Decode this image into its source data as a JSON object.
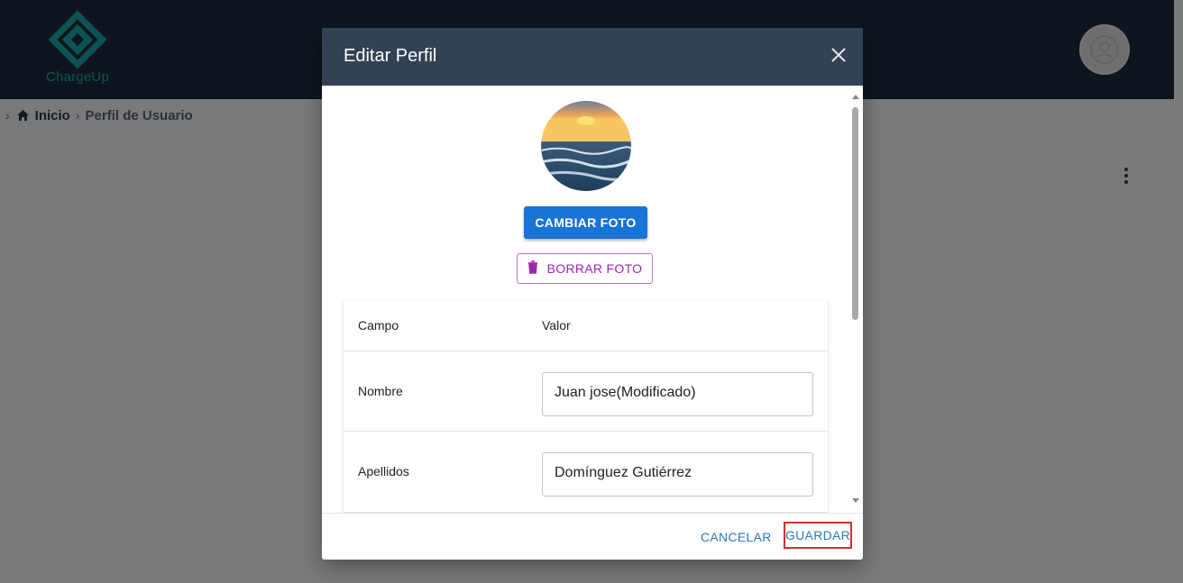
{
  "app": {
    "logo_text": "ChargeUp"
  },
  "breadcrumb": {
    "items": [
      "Inicio",
      "Perfil de Usuario"
    ]
  },
  "dialog": {
    "title": "Editar Perfil",
    "change_photo_label": "CAMBIAR FOTO",
    "delete_photo_label": "BORRAR FOTO",
    "table": {
      "headers": [
        "Campo",
        "Valor"
      ],
      "rows": [
        {
          "label": "Nombre",
          "value": "Juan jose(Modificado)"
        },
        {
          "label": "Apellidos",
          "value": "Domínguez Gutiérrez"
        }
      ]
    },
    "cancel_label": "CANCELAR",
    "save_label": "GUARDAR"
  },
  "icons": {
    "logo": "chargeup-logo-icon",
    "home": "home-icon",
    "chevron": "chevron-right-icon",
    "avatar": "user-avatar-icon",
    "kebab": "more-vert-icon",
    "close": "close-icon",
    "delete": "trash-icon"
  },
  "colors": {
    "appbar": "#1f2a3c",
    "dialog_header": "#334155",
    "primary_button": "#1a73d6",
    "delete_button": "#9c27b0",
    "text_button": "#2c7bbd",
    "highlight": "#d32f2f",
    "logo": "#1aa7a7"
  }
}
